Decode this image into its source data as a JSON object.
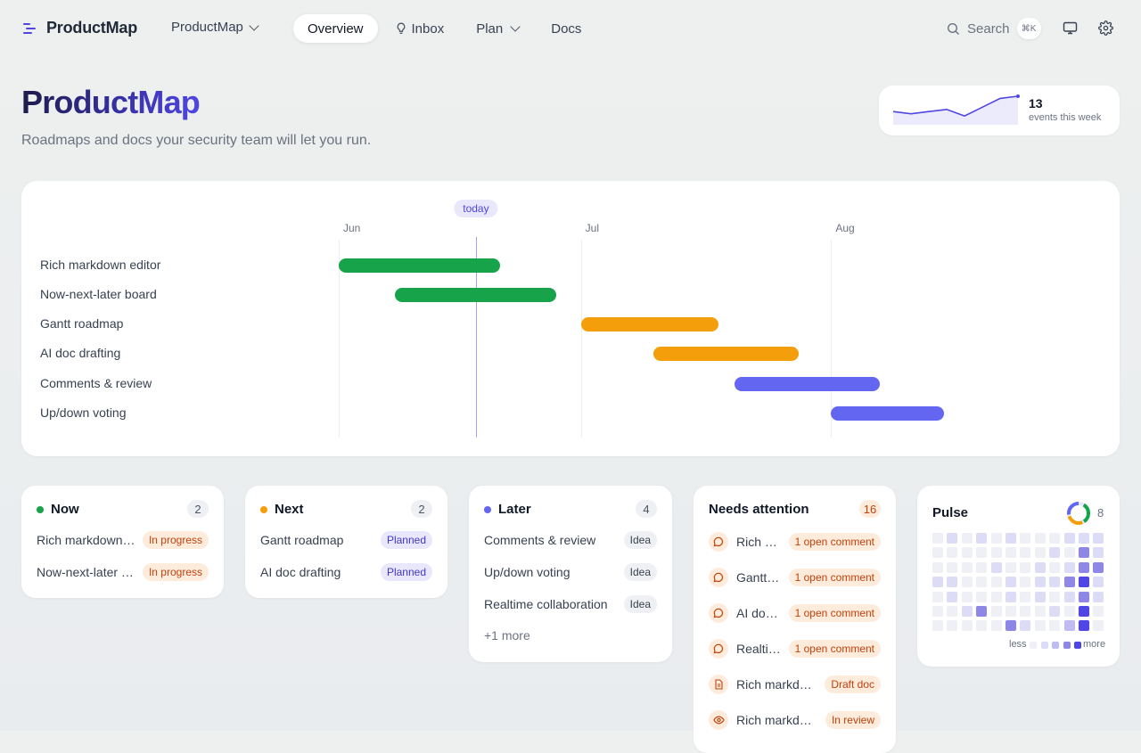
{
  "nav": {
    "brand": "ProductMap",
    "workspace": "ProductMap",
    "tabs": [
      {
        "label": "Overview",
        "icon": ""
      },
      {
        "label": "Inbox",
        "icon": "lightbulb-icon"
      },
      {
        "label": "Plan",
        "icon": ""
      },
      {
        "label": "Docs",
        "icon": ""
      }
    ],
    "search_label": "Search",
    "search_shortcut": "⌘K"
  },
  "hero": {
    "title": "ProductMap",
    "subtitle": "Roadmaps and docs your security team will let you run."
  },
  "activity": {
    "count": "13",
    "label": "events this week",
    "series": [
      3,
      2.5,
      3,
      3.5,
      2,
      4,
      6,
      6.5
    ],
    "color": "#4f46e5"
  },
  "roadmap": {
    "months": [
      "Jun",
      "Jul",
      "Aug"
    ],
    "today_label": "today",
    "timeline_start": "2024-06-01",
    "timeline_end": "2024-08-31",
    "today": "2024-06-18",
    "rows": [
      {
        "label": "Rich markdown editor",
        "start": "2024-06-01",
        "end": "2024-06-21",
        "color": "#16a34a"
      },
      {
        "label": "Now-next-later board",
        "start": "2024-06-08",
        "end": "2024-06-28",
        "color": "#16a34a"
      },
      {
        "label": "Gantt roadmap",
        "start": "2024-07-01",
        "end": "2024-07-18",
        "color": "#f59e0b"
      },
      {
        "label": "AI doc drafting",
        "start": "2024-07-10",
        "end": "2024-07-28",
        "color": "#f59e0b"
      },
      {
        "label": "Comments & review",
        "start": "2024-07-20",
        "end": "2024-08-07",
        "color": "#6366f1"
      },
      {
        "label": "Up/down voting",
        "start": "2024-08-01",
        "end": "2024-08-15",
        "color": "#6366f1"
      }
    ]
  },
  "board": {
    "now": {
      "title": "Now",
      "count": "2",
      "color": "#16a34a",
      "items": [
        {
          "text": "Rich markdown editor",
          "badge": "In progress"
        },
        {
          "text": "Now-next-later board",
          "badge": "In progress"
        }
      ]
    },
    "next": {
      "title": "Next",
      "count": "2",
      "color": "#f59e0b",
      "items": [
        {
          "text": "Gantt roadmap",
          "badge": "Planned"
        },
        {
          "text": "AI doc drafting",
          "badge": "Planned"
        }
      ]
    },
    "later": {
      "title": "Later",
      "count": "4",
      "color": "#6366f1",
      "items": [
        {
          "text": "Comments & review",
          "badge": "Idea"
        },
        {
          "text": "Up/down voting",
          "badge": "Idea"
        },
        {
          "text": "Realtime collaboration",
          "badge": "Idea"
        }
      ],
      "more": "+1 more"
    }
  },
  "attention": {
    "title": "Needs attention",
    "count": "16",
    "items": [
      {
        "icon": "comment-icon",
        "text": "Rich markdown editor",
        "badge": "1 open comment"
      },
      {
        "icon": "comment-icon",
        "text": "Gantt roadmap",
        "badge": "1 open comment"
      },
      {
        "icon": "comment-icon",
        "text": "AI doc drafting",
        "badge": "1 open comment"
      },
      {
        "icon": "comment-icon",
        "text": "Realtime collaboration",
        "badge": "1 open comment"
      },
      {
        "icon": "document-icon",
        "text": "Rich markdown editor",
        "badge": "Draft doc"
      },
      {
        "icon": "eye-icon",
        "text": "Rich markdown editor",
        "badge": "In review"
      }
    ]
  },
  "pulse": {
    "title": "Pulse",
    "count": "8",
    "legend_less": "less",
    "legend_more": "more",
    "palette": [
      "#eef0f6",
      "#dcdcf6",
      "#c0bcf2",
      "#8e87e6",
      "#4f46e5"
    ],
    "grid": [
      [
        0,
        1,
        0,
        1,
        0,
        1,
        0,
        0,
        0,
        1,
        1,
        1
      ],
      [
        0,
        0,
        0,
        0,
        0,
        0,
        0,
        0,
        1,
        0,
        3,
        1
      ],
      [
        0,
        0,
        0,
        0,
        1,
        0,
        0,
        1,
        0,
        1,
        3,
        3
      ],
      [
        1,
        1,
        0,
        0,
        0,
        1,
        0,
        1,
        1,
        3,
        4,
        1
      ],
      [
        0,
        1,
        0,
        0,
        0,
        1,
        0,
        1,
        0,
        1,
        3,
        1
      ],
      [
        0,
        0,
        1,
        3,
        0,
        0,
        0,
        0,
        1,
        0,
        4,
        0
      ],
      [
        0,
        0,
        0,
        0,
        0,
        3,
        1,
        0,
        0,
        2,
        4,
        0
      ]
    ]
  }
}
